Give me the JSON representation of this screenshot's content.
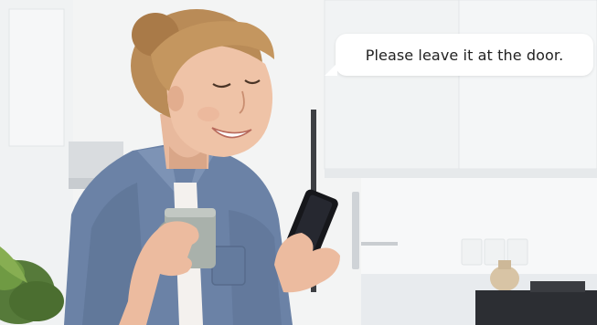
{
  "speech_bubble": {
    "text": "Please leave it at the door."
  },
  "scene": {
    "subject": "smiling woman",
    "objects": [
      "coffee-mug",
      "smartphone",
      "potted-plant"
    ],
    "colors": {
      "wall": "#f3f4f4",
      "shirt": "#6b82a6",
      "hair": "#b98b57",
      "mug": "#a9b1ab",
      "phone": "#16171b",
      "bubble": "#ffffff"
    }
  }
}
